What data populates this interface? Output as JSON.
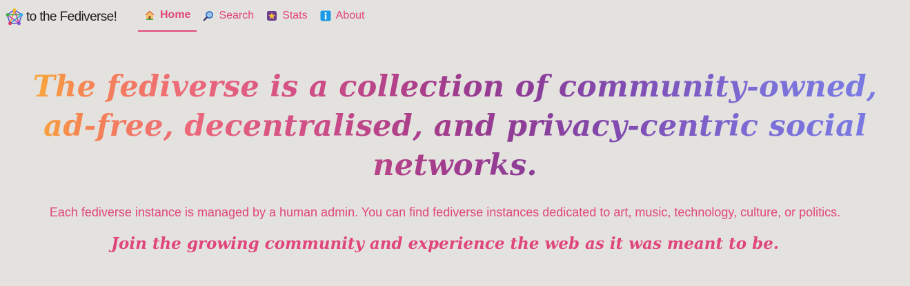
{
  "brand": {
    "text": "to the Fediverse!",
    "logo_icon": "fediverse-pentagram-icon"
  },
  "nav": {
    "items": [
      {
        "label": "Home",
        "icon": "house-icon",
        "active": true
      },
      {
        "label": "Search",
        "icon": "magnifier-icon",
        "active": false
      },
      {
        "label": "Stats",
        "icon": "stats-icon",
        "active": false
      },
      {
        "label": "About",
        "icon": "info-icon",
        "active": false
      }
    ]
  },
  "hero": {
    "headline": "The fediverse is a collection of community-owned, ad-free, decentralised, and privacy-centric social networks.",
    "subtext": "Each fediverse instance is managed by a human admin. You can find fediverse instances dedicated to art, music, technology, culture, or politics.",
    "cta": "Join the growing community and experience the web as it was meant to be."
  },
  "colors": {
    "background": "#e4e2df",
    "accent": "#e0457b",
    "gradient": [
      "#fbbf2c",
      "#f6884f",
      "#ee6a7a",
      "#d24f86",
      "#a43c8c",
      "#8d3d98",
      "#7f4fb6",
      "#7b6ed6",
      "#7a7ee8"
    ]
  }
}
